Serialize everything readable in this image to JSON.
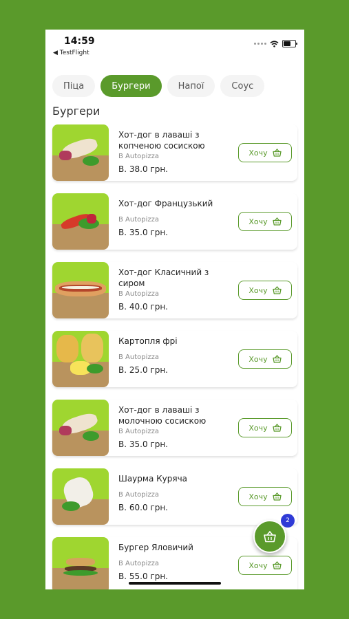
{
  "status": {
    "time": "14:59",
    "back": "◀ TestFlight"
  },
  "tabs": [
    {
      "label": "Піца",
      "active": false
    },
    {
      "label": "Бургери",
      "active": true
    },
    {
      "label": "Напої",
      "active": false
    },
    {
      "label": "Соус",
      "active": false
    }
  ],
  "section_title": "Бургери",
  "want_label": "Хочу",
  "products": [
    {
      "name": "Хот-дог в лаваші з копченою сосискою",
      "shop": "В Autopizza",
      "price": "В. 38.0 грн.",
      "image": "wrap"
    },
    {
      "name": "Хот-дог Французький",
      "shop": "В Autopizza",
      "price": "В. 35.0 грн.",
      "image": "french"
    },
    {
      "name": "Хот-дог Класичний з сиром",
      "shop": "В Autopizza",
      "price": "В. 40.0 грн.",
      "image": "classic"
    },
    {
      "name": "Картопля фрі",
      "shop": "В Autopizza",
      "price": "В. 25.0 грн.",
      "image": "fries"
    },
    {
      "name": "Хот-дог в лаваші з молочною сосискою",
      "shop": "В Autopizza",
      "price": "В. 35.0 грн.",
      "image": "wrap"
    },
    {
      "name": "Шаурма Куряча",
      "shop": "В Autopizza",
      "price": "В. 60.0 грн.",
      "image": "shawarma"
    },
    {
      "name": "Бургер Яловичий",
      "shop": "В Autopizza",
      "price": "В. 55.0 грн.",
      "image": "burger"
    }
  ],
  "cart": {
    "count": "2"
  },
  "colors": {
    "accent": "#5a9a2b",
    "badge": "#2f3bd6"
  }
}
